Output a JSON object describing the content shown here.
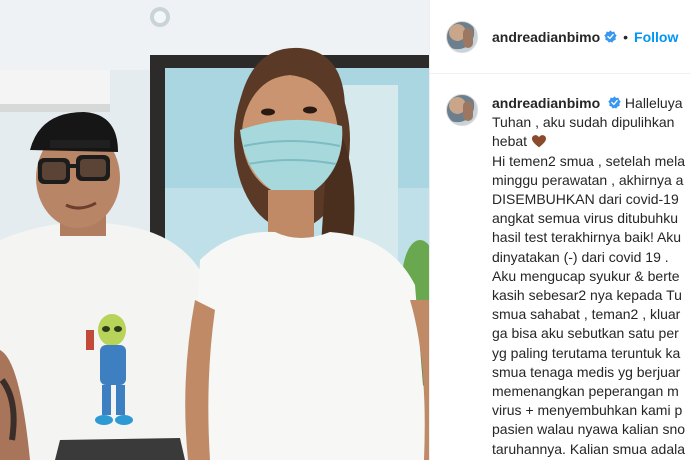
{
  "post": {
    "username": "andreadianbimo",
    "separator": "•",
    "follow_label": "Follow",
    "verified_icon": "verified-badge-icon",
    "colors": {
      "accent": "#0095f6",
      "verified": "#3897f0",
      "text": "#262626",
      "heart": "#8b4a2b"
    }
  },
  "caption": {
    "username": "andreadianbimo",
    "lines": [
      "Halleluya",
      "Tuhan , aku sudah dipulihkan",
      "hebat",
      "Hi temen2 smua ,  setelah mela",
      "minggu perawatan , akhirnya a",
      "DISEMBUHKAN dari covid-19",
      "angkat semua virus ditubuhku",
      "hasil test terakhirnya baik! Aku",
      "dinyatakan (-) dari covid 19 .",
      "Aku mengucap syukur & berte",
      "kasih sebesar2 nya kepada Tu",
      "smua sahabat , teman2 , kluar",
      "ga bisa aku sebutkan satu per",
      "yg paling terutama teruntuk ka",
      "smua tenaga medis yg berjuar",
      "memenangkan peperangan m",
      "virus + menyembuhkan kami p",
      "pasien walau nyawa kalian sno",
      "taruhannya. Kalian smua adala"
    ],
    "heart_icon": "brown-heart-icon"
  },
  "photo": {
    "alt_name": "post-photo"
  }
}
